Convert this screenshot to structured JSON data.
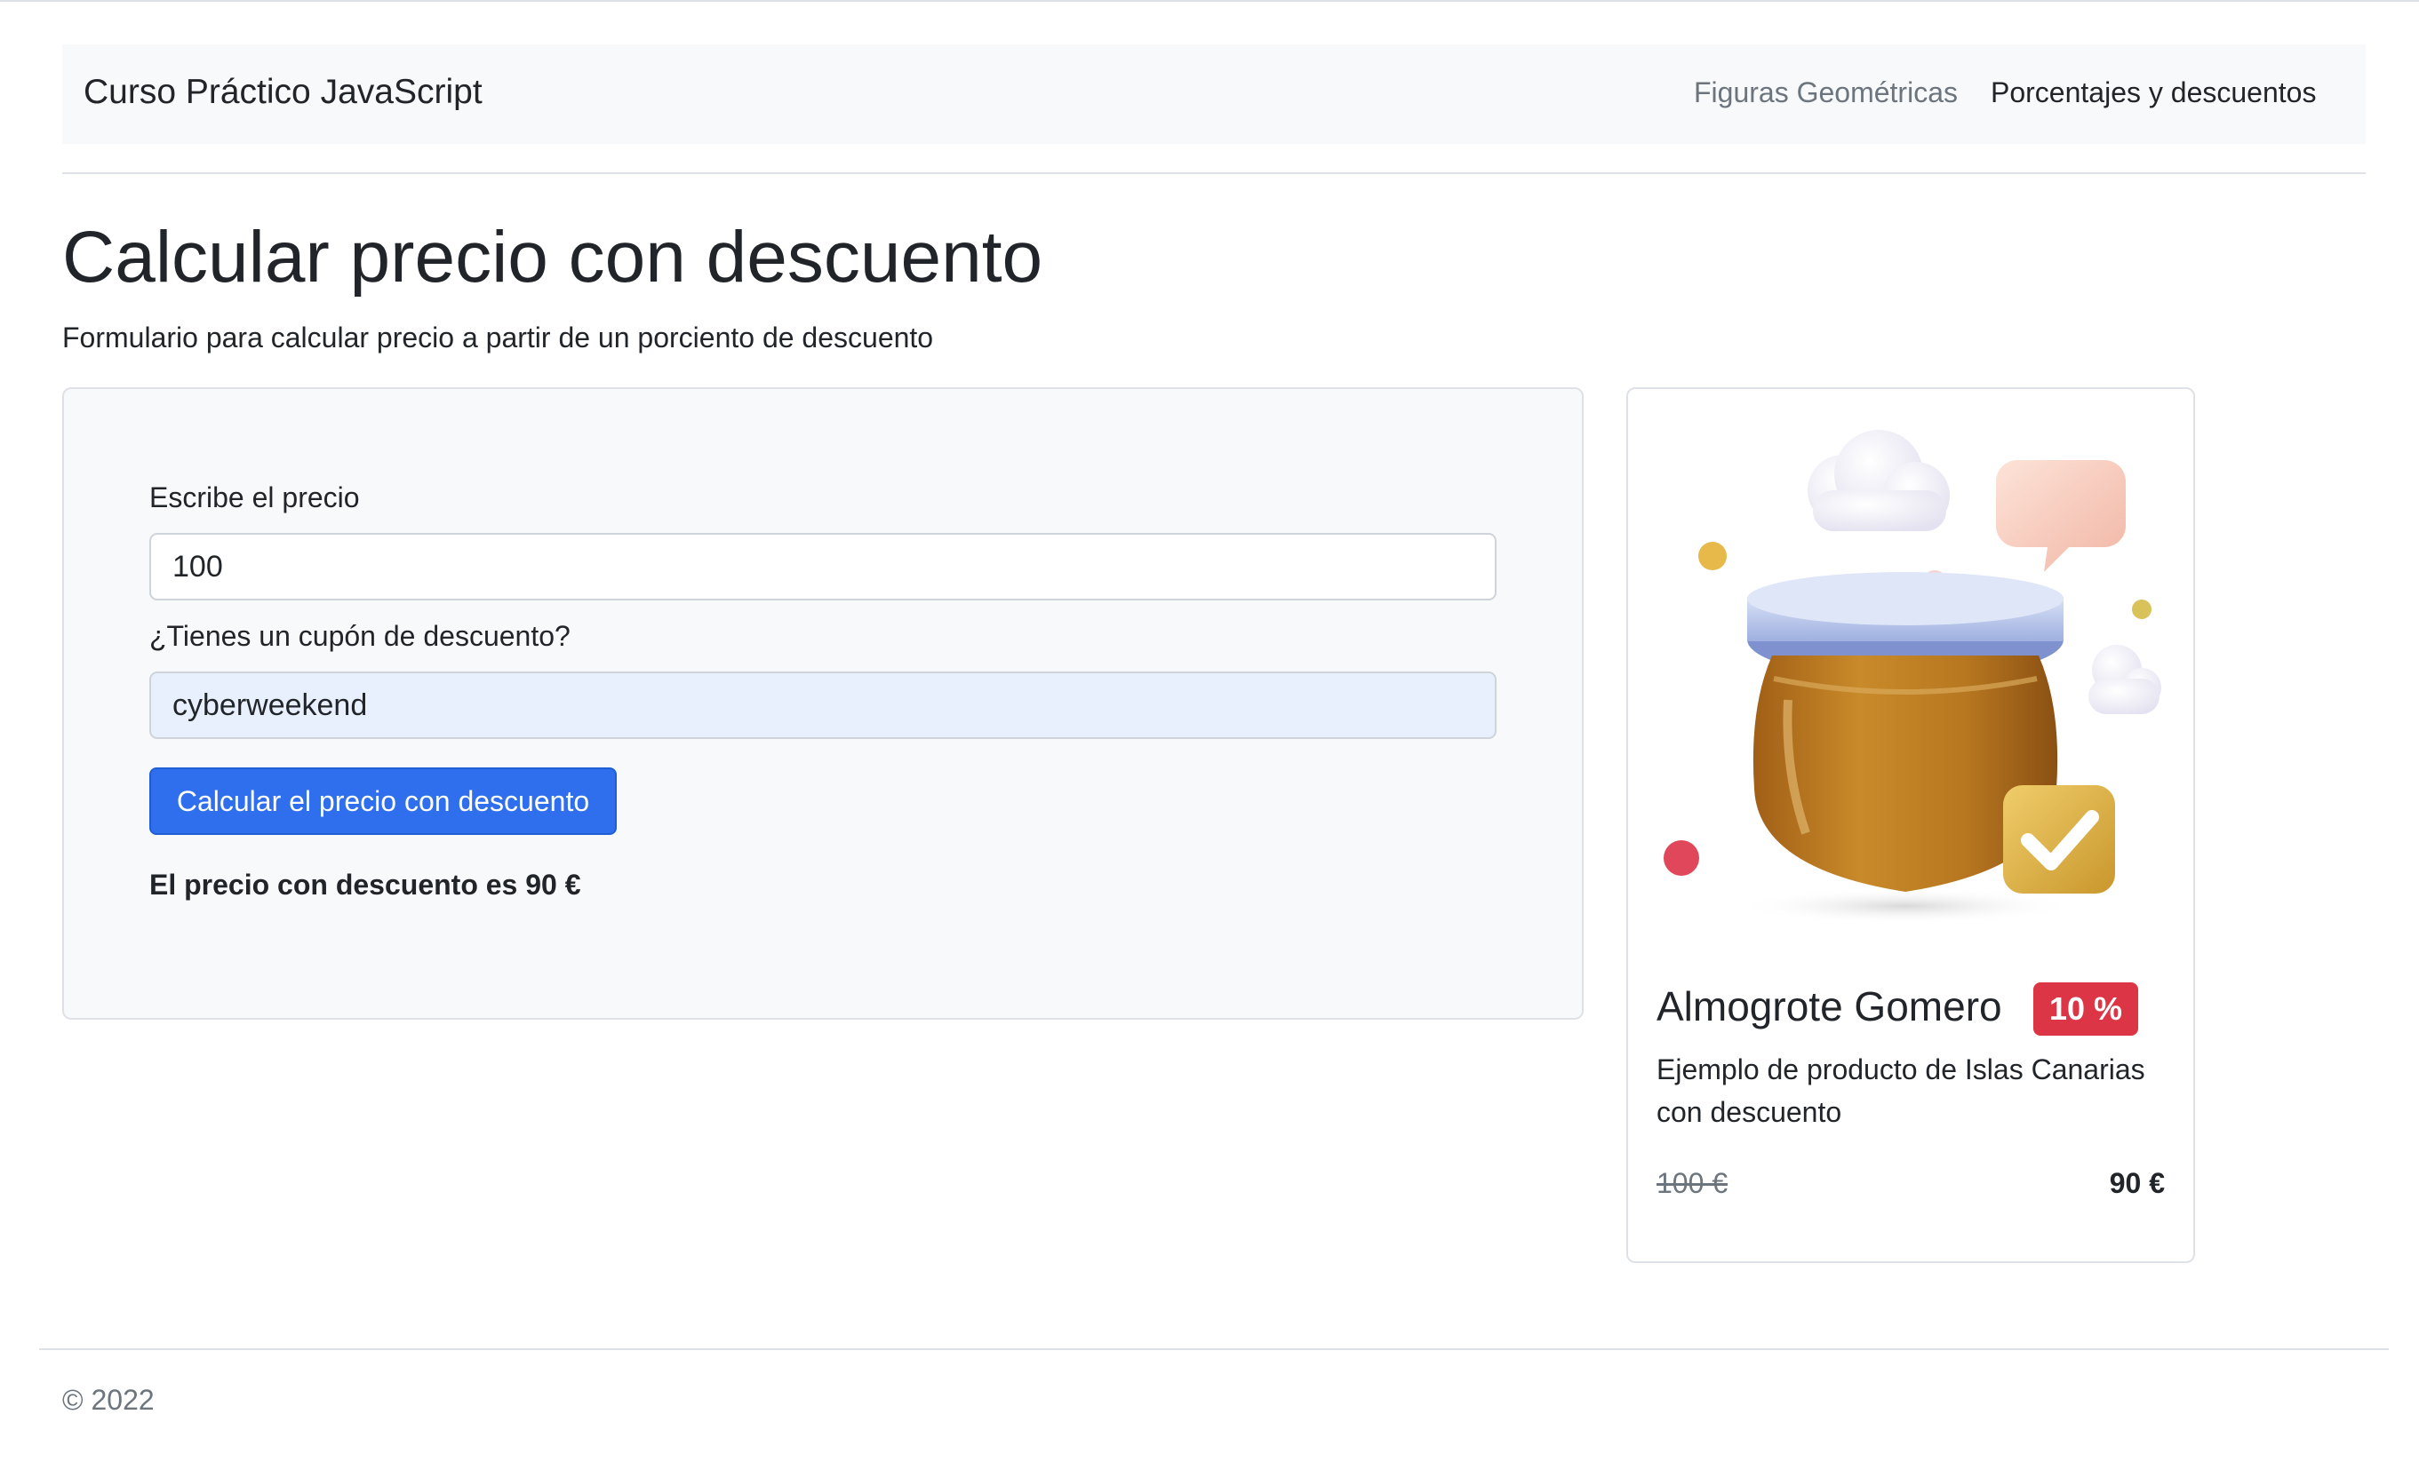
{
  "navbar": {
    "brand": "Curso Práctico JavaScript",
    "links": [
      {
        "label": "Figuras Geométricas"
      },
      {
        "label": "Porcentajes y descuentos"
      }
    ]
  },
  "page": {
    "title": "Calcular precio con descuento",
    "lead": "Formulario para calcular precio a partir de un porciento de descuento"
  },
  "form": {
    "price_label": "Escribe el precio",
    "price_value": "100",
    "coupon_label": "¿Tienes un cupón de descuento?",
    "coupon_value": "cyberweekend",
    "submit_label": "Calcular el precio con descuento",
    "result": "El precio con descuento es 90 €"
  },
  "product": {
    "name": "Almogrote Gomero",
    "discount_badge": "10 %",
    "description": "Ejemplo de producto de Islas Canarias con descuento",
    "old_price": "100 €",
    "new_price": "90 €",
    "image_icon": "jar-with-checkmark-illustration"
  },
  "footer": {
    "text": "© 2022"
  },
  "colors": {
    "primary": "#2f6fed",
    "danger": "#dc3545",
    "panel": "#f8f9fa",
    "coupon_fill": "#e8f0fe"
  }
}
